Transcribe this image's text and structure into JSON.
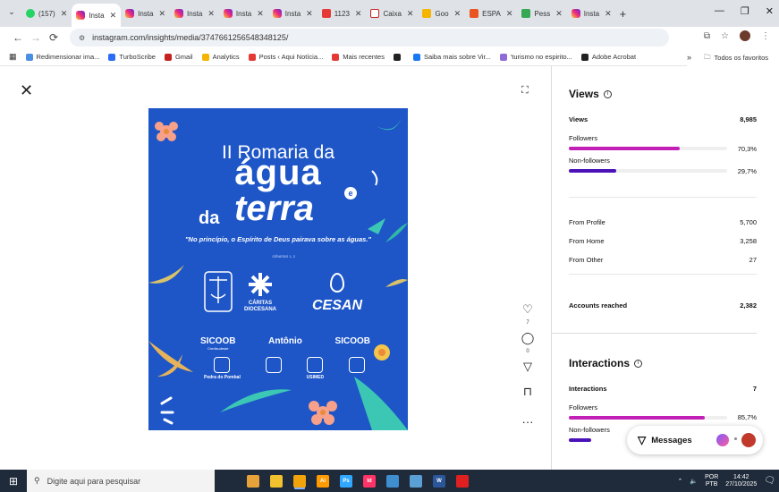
{
  "browser": {
    "tabs": [
      {
        "label": "(157)",
        "icon": "whatsapp-icon",
        "color": "#25d366",
        "active": false
      },
      {
        "label": "Insta",
        "icon": "instagram-icon",
        "active": true
      },
      {
        "label": "Insta",
        "icon": "instagram-icon",
        "active": false
      },
      {
        "label": "Insta",
        "icon": "instagram-icon",
        "active": false
      },
      {
        "label": "Insta",
        "icon": "instagram-icon",
        "active": false
      },
      {
        "label": "Insta",
        "icon": "instagram-icon",
        "active": false
      },
      {
        "label": "1123",
        "icon": "calendar-icon",
        "active": false
      },
      {
        "label": "Caixa",
        "icon": "gmail-icon",
        "active": false
      },
      {
        "label": "Goo",
        "icon": "analytics-icon",
        "active": false
      },
      {
        "label": "ESPA",
        "icon": "site-icon",
        "active": false
      },
      {
        "label": "Pess",
        "icon": "drive-icon",
        "active": false
      },
      {
        "label": "Insta",
        "icon": "instagram-icon",
        "active": false
      }
    ],
    "tab_close": "✕",
    "new_tab": "+",
    "window_controls": {
      "minimize": "—",
      "restore": "❐",
      "close": "✕"
    },
    "url": "instagram.com/insights/media/3747661256548348125/",
    "bookmarks": [
      {
        "label": "Redimensionar ima...",
        "color": "#4a90e2"
      },
      {
        "label": "TurboScribe",
        "color": "#2b6cf6"
      },
      {
        "label": "Gmail",
        "color": "#c5221f"
      },
      {
        "label": "Analytics",
        "color": "#f4b400"
      },
      {
        "label": "Posts ‹ Aqui Notícia...",
        "color": "#e53935"
      },
      {
        "label": "Mais recentes",
        "color": "#e53935"
      },
      {
        "label": "",
        "color": "#222222"
      },
      {
        "label": "Saiba mais sobre Vir...",
        "color": "#1877f2"
      },
      {
        "label": "'turismo no espirito...",
        "color": "#8e6bd8"
      },
      {
        "label": "Adobe Acrobat",
        "color": "#222222"
      }
    ],
    "bookmarks_more": "»",
    "bookmarks_all": "Todos os favoritos"
  },
  "post": {
    "title_line1": "II Romaria da",
    "title_line2": "água",
    "title_da": "da",
    "title_terra": "terra",
    "title_e": "e",
    "quote": "\"No princípio, o Espírito de Deus pairava sobre as águas.\"",
    "quote_ref": "GÊNESIS 1, 2",
    "caritas_label": "CÁRITAS DIOCESANA",
    "cesan_label": "CESAN",
    "sponsors": [
      {
        "name": "SICOOB",
        "sub": "Credisudeste"
      },
      {
        "name": "Antônio",
        "sub": ""
      },
      {
        "name": "SICOOB",
        "sub": ""
      }
    ],
    "sponsors2": [
      "Pedra do Pombal",
      "",
      "USIMED",
      ""
    ],
    "bg_color": "#1e56c8"
  },
  "actions": {
    "likes": "7",
    "comments": "0"
  },
  "views": {
    "heading": "Views",
    "total_label": "Views",
    "total": "8,985",
    "followers_label": "Followers",
    "followers_pct": "70,3%",
    "followers_fraction": 0.703,
    "nonfollowers_label": "Non-followers",
    "nonfollowers_pct": "29,7%",
    "nonfollowers_fraction": 0.297,
    "sources": [
      {
        "label": "From Profile",
        "value": "5,700"
      },
      {
        "label": "From Home",
        "value": "3,258"
      },
      {
        "label": "From Other",
        "value": "27"
      }
    ],
    "accounts_reached_label": "Accounts reached",
    "accounts_reached": "2,382"
  },
  "interactions": {
    "heading": "Interactions",
    "total_label": "Interactions",
    "total": "7",
    "followers_label": "Followers",
    "followers_pct": "85,7%",
    "followers_fraction": 0.857,
    "nonfollowers_label": "Non-followers",
    "nonfollowers_fraction": 0.143
  },
  "messages": {
    "label": "Messages"
  },
  "colors": {
    "followers_bar": "#c11fb6",
    "nonfollowers_bar": "#4b12b8"
  },
  "taskbar": {
    "search_placeholder": "Digite aqui para pesquisar",
    "apps": [
      {
        "icon": "app-icon",
        "color": "#e8a23a"
      },
      {
        "icon": "file-explorer-icon",
        "color": "#f2c12e"
      },
      {
        "icon": "chrome-icon",
        "color": "#f0a30a"
      },
      {
        "icon": "illustrator-icon",
        "color": "#ff9a00",
        "label": "Ai"
      },
      {
        "icon": "photoshop-icon",
        "color": "#31a8ff",
        "label": "Ps"
      },
      {
        "icon": "indesign-icon",
        "color": "#ff3366",
        "label": "Id"
      },
      {
        "icon": "app-icon",
        "color": "#3e8ed0"
      },
      {
        "icon": "app-icon",
        "color": "#5aa0d6"
      },
      {
        "icon": "word-icon",
        "color": "#2b579a",
        "label": "W"
      },
      {
        "icon": "acrobat-icon",
        "color": "#e02020"
      }
    ],
    "lang1": "POR",
    "lang2": "PTB",
    "time": "14:42",
    "date": "27/10/2025"
  }
}
